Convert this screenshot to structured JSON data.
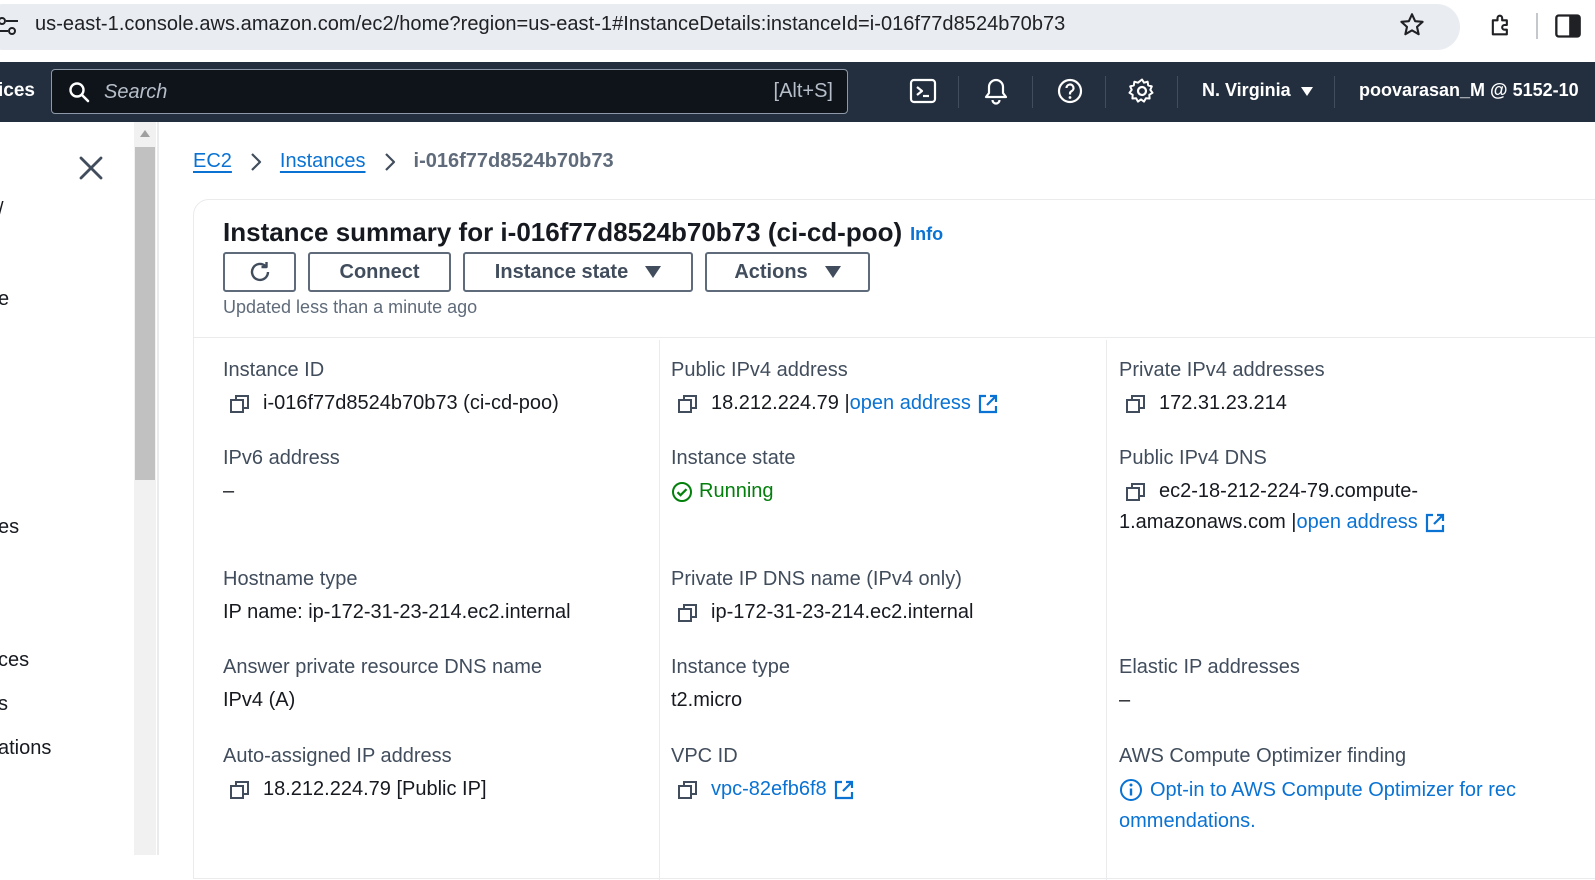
{
  "browser": {
    "url": "us-east-1.console.aws.amazon.com/ec2/home?region=us-east-1#InstanceDetails:instanceId=i-016f77d8524b70b73"
  },
  "nav": {
    "services_fragment": "ices",
    "search_placeholder": "Search",
    "search_shortcut": "[Alt+S]",
    "region": "N. Virginia",
    "account": "poovarasan_M @ 5152-10"
  },
  "sidebar": {
    "fragments": [
      "/",
      "e",
      "es",
      "ces",
      "s",
      "ations"
    ]
  },
  "breadcrumb": {
    "items": [
      "EC2",
      "Instances"
    ],
    "current": "i-016f77d8524b70b73"
  },
  "summary": {
    "title": "Instance summary for i-016f77d8524b70b73 (ci-cd-poo)",
    "info": "Info",
    "buttons": {
      "connect": "Connect",
      "instance_state": "Instance state",
      "actions": "Actions"
    },
    "updated": "Updated less than a minute ago"
  },
  "details": {
    "instance_id": {
      "label": "Instance ID",
      "value": "i-016f77d8524b70b73 (ci-cd-poo)"
    },
    "public_ipv4": {
      "label": "Public IPv4 address",
      "value": "18.212.224.79 |",
      "link": "open address"
    },
    "private_ipv4": {
      "label": "Private IPv4 addresses",
      "value": "172.31.23.214"
    },
    "ipv6": {
      "label": "IPv6 address",
      "value": "–"
    },
    "instance_state": {
      "label": "Instance state",
      "value": "Running"
    },
    "public_dns": {
      "label": "Public IPv4 DNS",
      "line1": "ec2-18-212-224-79.compute-",
      "line2": "1.amazonaws.com |",
      "link": "open address"
    },
    "hostname_type": {
      "label": "Hostname type",
      "value": "IP name: ip-172-31-23-214.ec2.internal"
    },
    "private_dns": {
      "label": "Private IP DNS name (IPv4 only)",
      "value": "ip-172-31-23-214.ec2.internal"
    },
    "answer_dns": {
      "label": "Answer private resource DNS name",
      "value": "IPv4 (A)"
    },
    "instance_type": {
      "label": "Instance type",
      "value": "t2.micro"
    },
    "elastic_ip": {
      "label": "Elastic IP addresses",
      "value": "–"
    },
    "auto_ip": {
      "label": "Auto-assigned IP address",
      "value": "18.212.224.79 [Public IP]"
    },
    "vpc_id": {
      "label": "VPC ID",
      "value": "vpc-82efb6f8"
    },
    "optimizer": {
      "label": "AWS Compute Optimizer finding",
      "line1": "Opt-in to AWS Compute Optimizer for rec",
      "line2": "ommendations."
    }
  },
  "colors": {
    "nav_bg": "#232f3e",
    "link": "#0972d3",
    "success": "#037f0c"
  }
}
